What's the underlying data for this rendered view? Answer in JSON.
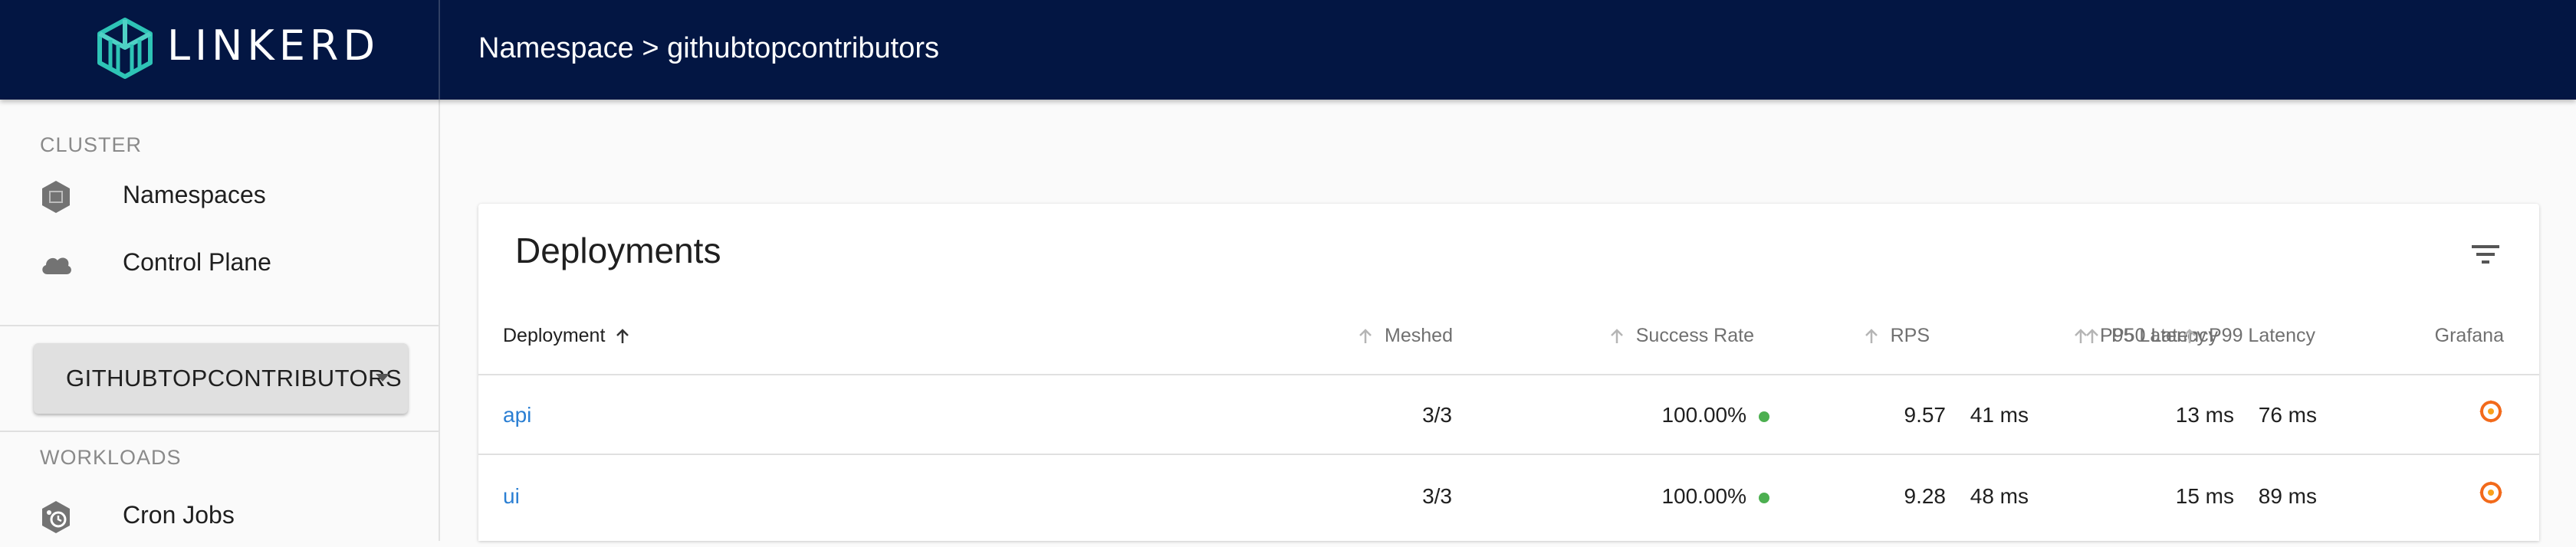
{
  "app": {
    "brand_name": "LINKERD",
    "page_title": "Namespace > githubtopcontributors"
  },
  "sidebar": {
    "cluster_label": "CLUSTER",
    "cluster_items": [
      {
        "label": "Namespaces",
        "icon": "namespace-icon"
      },
      {
        "label": "Control Plane",
        "icon": "cloud-icon"
      }
    ],
    "namespace_select": {
      "selected": "GITHUBTOPCONTRIBUTORS"
    },
    "workloads_label": "WORKLOADS",
    "workload_items": [
      {
        "label": "Cron Jobs",
        "icon": "cron-jobs-icon"
      }
    ]
  },
  "table": {
    "title": "Deployments",
    "columns": [
      "Deployment",
      "Meshed",
      "Success Rate",
      "RPS",
      "P50 Latency",
      "P95 Latency",
      "P99 Latency",
      "Grafana"
    ],
    "rows": [
      {
        "deployment": "api",
        "meshed": "3/3",
        "success_rate": "100.00%",
        "rps": "9.57",
        "p50": "13 ms",
        "p95": "41 ms",
        "p99": "76 ms"
      },
      {
        "deployment": "ui",
        "meshed": "3/3",
        "success_rate": "100.00%",
        "rps": "9.28",
        "p50": "15 ms",
        "p95": "48 ms",
        "p99": "89 ms"
      }
    ]
  },
  "colors": {
    "topbar": "#031643",
    "link": "#2b7fd3",
    "success": "#4caf50",
    "grafana": "#f26a1b"
  }
}
